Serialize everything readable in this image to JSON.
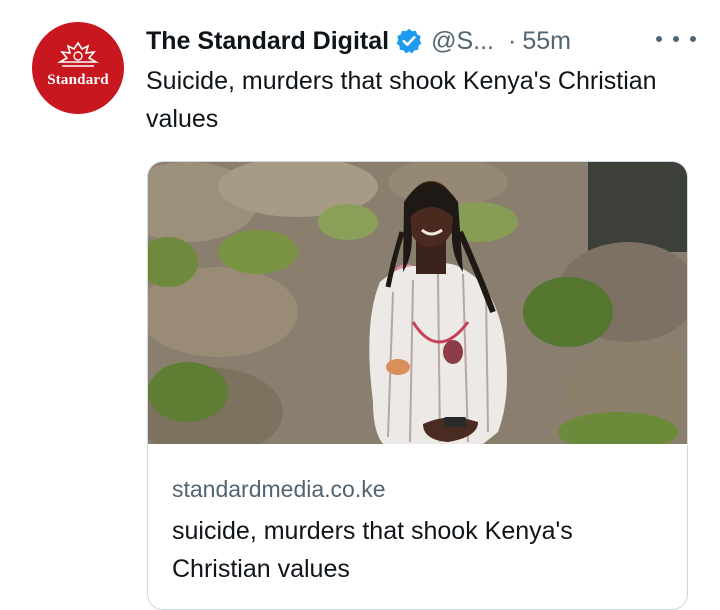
{
  "account": {
    "avatar_text": "Standard",
    "name": "The Standard Digital",
    "handle": "@S...",
    "separator": "·",
    "time": "55m",
    "verified_icon": "verified-badge-icon",
    "more_icon": "more-options-icon"
  },
  "tweet": {
    "text": "Suicide, murders that shook Kenya's Christian values"
  },
  "card": {
    "domain": "standardmedia.co.ke",
    "title": "suicide, murders that shook Kenya's Christian values",
    "image_alt": "Photo of a woman smiling outdoors among rocks and green shrubs"
  },
  "colors": {
    "avatar_bg": "#c8171e",
    "verified": "#1d9bf0",
    "secondary_text": "#536471",
    "border": "#cfd9de"
  }
}
